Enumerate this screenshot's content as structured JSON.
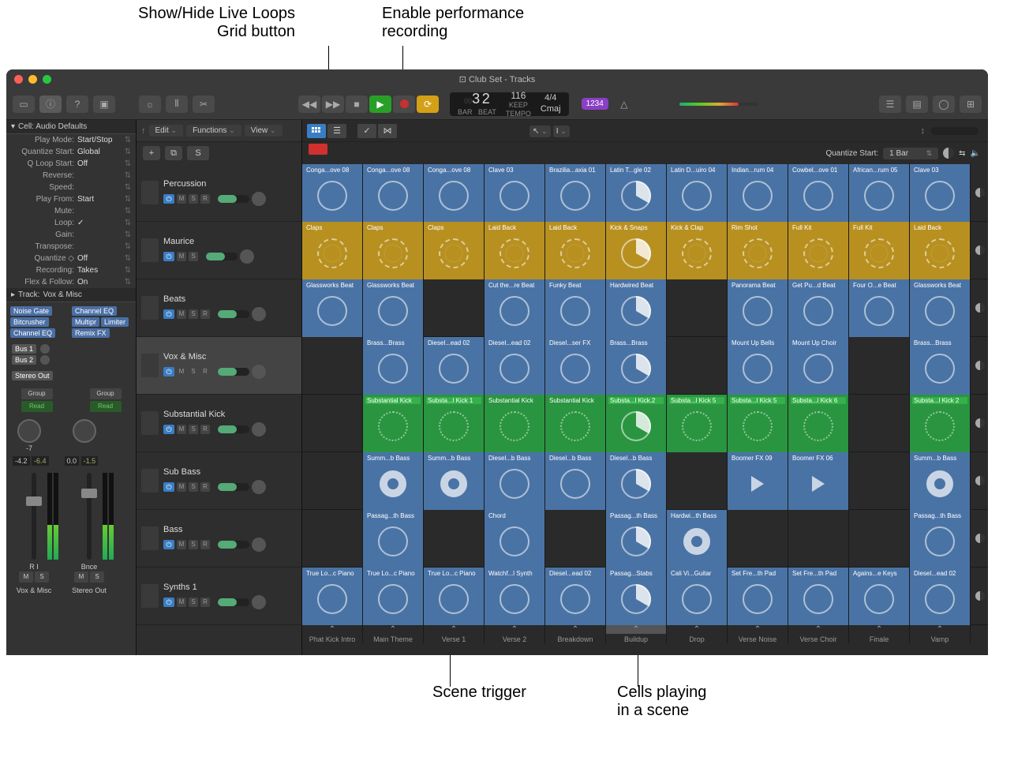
{
  "callouts": {
    "top_left": "Show/Hide Live Loops\nGrid button",
    "top_right": "Enable performance\nrecording",
    "bottom_left": "Scene trigger",
    "bottom_right": "Cells playing\nin a scene"
  },
  "window_title": "Club Set - Tracks",
  "lcd": {
    "bars": "3",
    "beats": "2",
    "bar_lbl": "BAR",
    "beat_lbl": "BEAT",
    "tempo": "116",
    "keep": "KEEP",
    "tempo_lbl": "TEMPO",
    "sig": "4/4",
    "key": "Cmaj",
    "badge": "1234"
  },
  "left_panel": {
    "title": "Cell: Audio Defaults",
    "rows": [
      {
        "label": "Play Mode:",
        "value": "Start/Stop"
      },
      {
        "label": "Quantize Start:",
        "value": "Global"
      },
      {
        "label": "Q Loop Start:",
        "value": "Off"
      },
      {
        "label": "Reverse:",
        "value": ""
      },
      {
        "label": "Speed:",
        "value": ""
      },
      {
        "label": "Play From:",
        "value": "Start"
      },
      {
        "label": "Mute:",
        "value": ""
      },
      {
        "label": "Loop:",
        "value": "✓"
      },
      {
        "label": "Gain:",
        "value": ""
      },
      {
        "label": "Transpose:",
        "value": ""
      },
      {
        "label": "Quantize ◇",
        "value": "Off"
      },
      {
        "label": "Recording:",
        "value": "Takes"
      },
      {
        "label": "Flex & Follow:",
        "value": "On"
      }
    ],
    "track_header": "Track:",
    "track_name": "Vox & Misc",
    "chips_l": [
      "Noise Gate",
      "Bitcrusher",
      "Channel EQ"
    ],
    "chips_r": [
      "Channel EQ",
      "Multipr",
      "Limiter",
      "Remix FX"
    ],
    "buses": [
      "Bus 1",
      "Bus 2"
    ],
    "stereo": "Stereo Out",
    "group": "Group",
    "read": "Read",
    "db_l": "-4.2",
    "db_l2": "-6.4",
    "db_r": "0.0",
    "db_r2": "-1.5",
    "strip_l": "Vox & Misc",
    "strip_r": "Stereo Out",
    "ri": "R  I",
    "bnce": "Bnce",
    "m": "M",
    "s": "S",
    "neg7": "-7"
  },
  "track_menus": {
    "edit": "Edit",
    "functions": "Functions",
    "view": "View"
  },
  "solo": "S",
  "quantize_start_label": "Quantize Start:",
  "quantize_start_value": "1 Bar",
  "tracks": [
    {
      "name": "Percussion"
    },
    {
      "name": "Maurice"
    },
    {
      "name": "Beats"
    },
    {
      "name": "Vox & Misc"
    },
    {
      "name": "Substantial Kick"
    },
    {
      "name": "Sub Bass"
    },
    {
      "name": "Bass"
    },
    {
      "name": "Synths 1"
    }
  ],
  "grid": [
    [
      {
        "c": "blue",
        "l": "Conga...ove 08"
      },
      {
        "c": "blue",
        "l": "Conga...ove 08"
      },
      {
        "c": "blue",
        "l": "Conga...ove 08"
      },
      {
        "c": "blue",
        "l": "Clave 03"
      },
      {
        "c": "blue",
        "l": "Brazilia...axia 01"
      },
      {
        "c": "blue",
        "l": "Latin T...gle 02",
        "p": 1
      },
      {
        "c": "blue",
        "l": "Latin D...uiro 04"
      },
      {
        "c": "blue",
        "l": "Indian...rum 04"
      },
      {
        "c": "blue",
        "l": "Cowbel...ove 01"
      },
      {
        "c": "blue",
        "l": "African...rum 05"
      },
      {
        "c": "blue",
        "l": "Clave 03"
      }
    ],
    [
      {
        "c": "yellow",
        "l": "Claps"
      },
      {
        "c": "yellow",
        "l": "Claps"
      },
      {
        "c": "yellow",
        "l": "Claps"
      },
      {
        "c": "yellow",
        "l": "Laid Back"
      },
      {
        "c": "yellow",
        "l": "Laid Back"
      },
      {
        "c": "yellow",
        "l": "Kick & Snaps",
        "p": 1
      },
      {
        "c": "yellow",
        "l": "Kick & Clap"
      },
      {
        "c": "yellow",
        "l": "Rim Shot"
      },
      {
        "c": "yellow",
        "l": "Full Kit"
      },
      {
        "c": "yellow",
        "l": "Full Kit"
      },
      {
        "c": "yellow",
        "l": "Laid Back"
      }
    ],
    [
      {
        "c": "blue",
        "l": "Glassworks Beat"
      },
      {
        "c": "blue",
        "l": "Glassworks Beat"
      },
      {},
      {
        "c": "blue",
        "l": "Cut the...re Beat"
      },
      {
        "c": "blue",
        "l": "Funky Beat"
      },
      {
        "c": "blue",
        "l": "Hardwired Beat",
        "p": 1
      },
      {},
      {
        "c": "blue",
        "l": "Panorama Beat"
      },
      {
        "c": "blue",
        "l": "Get Pu...d Beat"
      },
      {
        "c": "blue",
        "l": "Four O...e Beat"
      },
      {
        "c": "blue",
        "l": "Glassworks Beat"
      }
    ],
    [
      {},
      {
        "c": "blue",
        "l": "Brass...Brass"
      },
      {
        "c": "blue",
        "l": "Diesel...ead 02"
      },
      {
        "c": "blue",
        "l": "Diesel...ead 02"
      },
      {
        "c": "blue",
        "l": "Diesel...ser FX"
      },
      {
        "c": "blue",
        "l": "Brass...Brass",
        "p": 1
      },
      {},
      {
        "c": "blue",
        "l": "Mount Up Bells"
      },
      {
        "c": "blue",
        "l": "Mount Up Choir"
      },
      {},
      {
        "c": "blue",
        "l": "Brass...Brass"
      }
    ],
    [
      {},
      {
        "c": "green",
        "l": "Substantial Kick",
        "gl": 1
      },
      {
        "c": "green",
        "l": "Substa...l Kick 1",
        "gl": 1
      },
      {
        "c": "green",
        "l": "Substantial Kick"
      },
      {
        "c": "green",
        "l": "Substantial Kick"
      },
      {
        "c": "green",
        "l": "Substa...l Kick.2",
        "p": 1,
        "gl": 1
      },
      {
        "c": "green",
        "l": "Substa...l Kick 5",
        "gl": 1
      },
      {
        "c": "green",
        "l": "Substa...l Kick 5",
        "gl": 1
      },
      {
        "c": "green",
        "l": "Substa...l Kick 6",
        "gl": 1
      },
      {},
      {
        "c": "green",
        "l": "Substa...l Kick 2",
        "gl": 1
      }
    ],
    [
      {},
      {
        "c": "blue",
        "l": "Summ...b Bass",
        "t": "thick"
      },
      {
        "c": "blue",
        "l": "Summ...b Bass",
        "t": "thick"
      },
      {
        "c": "blue",
        "l": "Diesel...b Bass"
      },
      {
        "c": "blue",
        "l": "Diesel...b Bass"
      },
      {
        "c": "blue",
        "l": "Diesel...b Bass",
        "p": 1
      },
      {},
      {
        "c": "blue",
        "l": "Boomer FX 09",
        "t": "tri"
      },
      {
        "c": "blue",
        "l": "Boomer FX 06",
        "t": "tri"
      },
      {},
      {
        "c": "blue",
        "l": "Summ...b Bass",
        "t": "thick"
      }
    ],
    [
      {},
      {
        "c": "blue",
        "l": "Passag...th Bass"
      },
      {},
      {
        "c": "blue",
        "l": "Chord"
      },
      {},
      {
        "c": "blue",
        "l": "Passag...th Bass",
        "p": 1
      },
      {
        "c": "blue",
        "l": "Hardwi...th Bass",
        "t": "thick"
      },
      {},
      {},
      {},
      {
        "c": "blue",
        "l": "Passag...th Bass"
      }
    ],
    [
      {
        "c": "blue",
        "l": "True Lo...c Piano"
      },
      {
        "c": "blue",
        "l": "True Lo...c Piano"
      },
      {
        "c": "blue",
        "l": "True Lo...c Piano"
      },
      {
        "c": "blue",
        "l": "Watchf...l Synth"
      },
      {
        "c": "blue",
        "l": "Diesel...ead 02"
      },
      {
        "c": "blue",
        "l": "Passag...Stabs",
        "p": 1
      },
      {
        "c": "blue",
        "l": "Cali Vi...Guitar"
      },
      {
        "c": "blue",
        "l": "Set Fre...th Pad"
      },
      {
        "c": "blue",
        "l": "Set Fre...th Pad"
      },
      {
        "c": "blue",
        "l": "Agains...e Keys"
      },
      {
        "c": "blue",
        "l": "Diesel...ead 02"
      }
    ]
  ],
  "scenes": [
    "Phat Kick Intro",
    "Main Theme",
    "Verse 1",
    "Verse 2",
    "Breakdown",
    "Buildup",
    "Drop",
    "Verse Noise",
    "Verse Choir",
    "Finale",
    "Vamp"
  ],
  "active_scene": 5
}
